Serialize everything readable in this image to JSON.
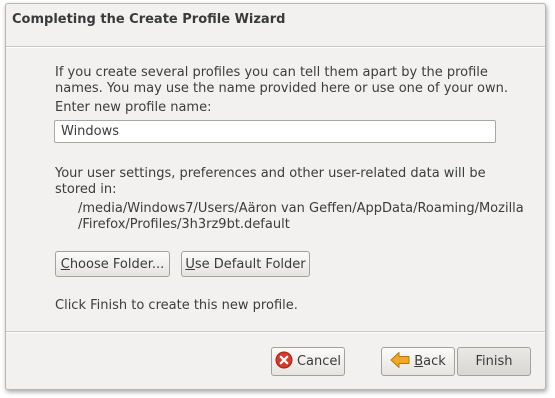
{
  "dialog": {
    "title": "Completing the Create Profile Wizard",
    "intro_line1": "If you create several profiles you can tell them apart by the profile",
    "intro_line2": "names. You may use the name provided here or use one of your own.",
    "name_label": "Enter new profile name:",
    "profile_name_value": "Windows",
    "storage_line1": "Your user settings, preferences and other user-related data will be",
    "storage_line2": "stored in:",
    "path_line1": "/media/Windows7/Users/Aäron van Geffen/AppData/Roaming/Mozilla",
    "path_line2": "/Firefox/Profiles/3h3rz9bt.default",
    "finish_hint": "Click Finish to create this new profile."
  },
  "buttons": {
    "choose_folder_mnemonic": "C",
    "choose_folder_rest": "hoose Folder...",
    "use_default_mnemonic": "U",
    "use_default_rest": "se Default Folder",
    "cancel": "Cancel",
    "back_mnemonic": "B",
    "back_rest": "ack",
    "finish": "Finish"
  },
  "icons": {
    "cancel": "cancel-icon",
    "back": "back-arrow-icon"
  },
  "colors": {
    "cancel_icon": "#d63a2a",
    "back_icon": "#f0a825"
  }
}
